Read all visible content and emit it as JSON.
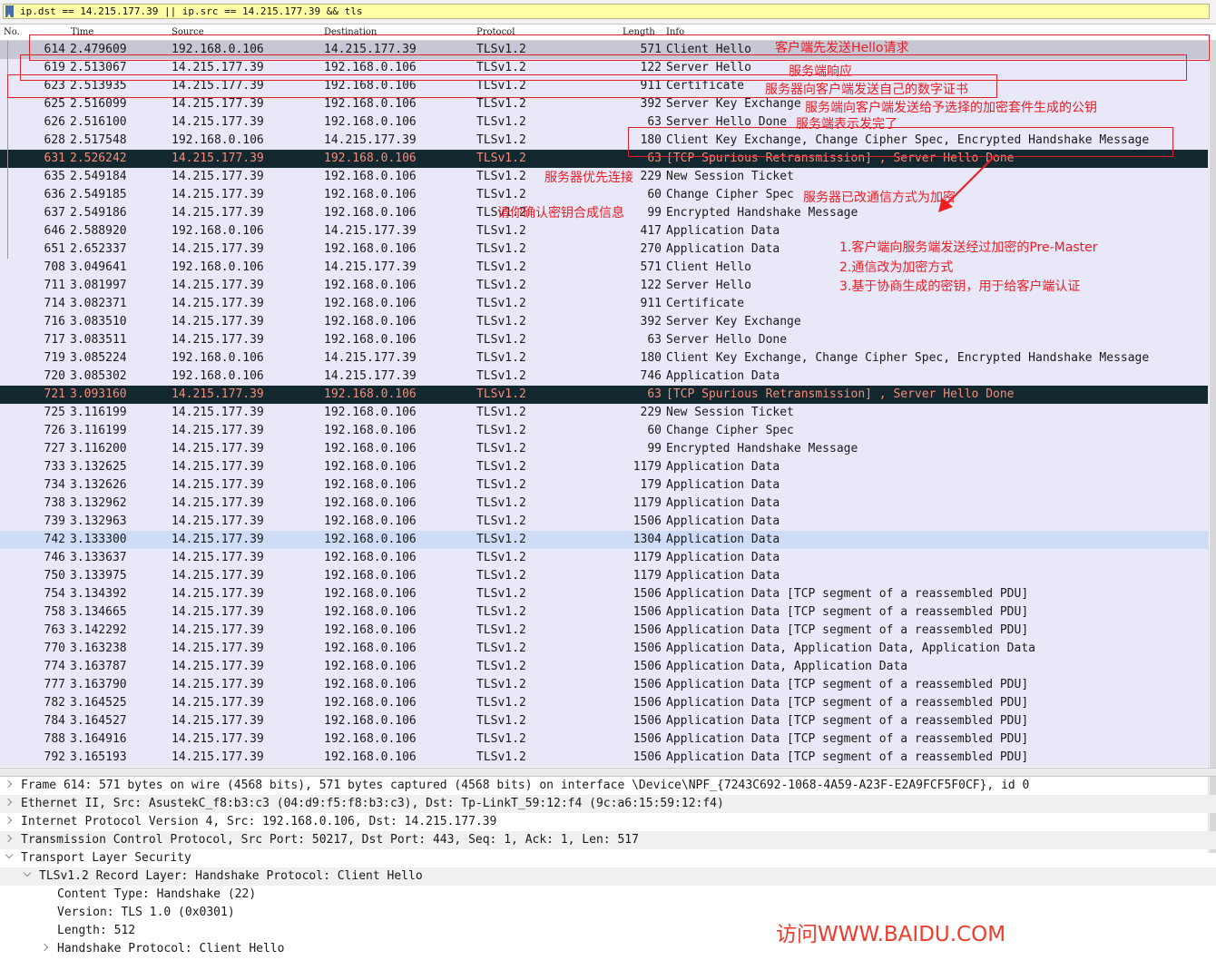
{
  "filter": {
    "icon": "bookmark-icon",
    "value": "ip.dst == 14.215.177.39 || ip.src == 14.215.177.39 && tls"
  },
  "columns": {
    "no": "No.",
    "time": "Time",
    "source": "Source",
    "destination": "Destination",
    "protocol": "Protocol",
    "length": "Length",
    "info": "Info"
  },
  "packets": [
    {
      "no": "614",
      "time": "2.479609",
      "src": "192.168.0.106",
      "dst": "14.215.177.39",
      "proto": "TLSv1.2",
      "len": "571",
      "info": "Client Hello",
      "state": "selected"
    },
    {
      "no": "619",
      "time": "2.513067",
      "src": "14.215.177.39",
      "dst": "192.168.0.106",
      "proto": "TLSv1.2",
      "len": "122",
      "info": "Server Hello",
      "state": "normal"
    },
    {
      "no": "623",
      "time": "2.513935",
      "src": "14.215.177.39",
      "dst": "192.168.0.106",
      "proto": "TLSv1.2",
      "len": "911",
      "info": "Certificate",
      "state": "normal"
    },
    {
      "no": "625",
      "time": "2.516099",
      "src": "14.215.177.39",
      "dst": "192.168.0.106",
      "proto": "TLSv1.2",
      "len": "392",
      "info": "Server Key Exchange",
      "state": "normal"
    },
    {
      "no": "626",
      "time": "2.516100",
      "src": "14.215.177.39",
      "dst": "192.168.0.106",
      "proto": "TLSv1.2",
      "len": "63",
      "info": "Server Hello Done",
      "state": "normal"
    },
    {
      "no": "628",
      "time": "2.517548",
      "src": "192.168.0.106",
      "dst": "14.215.177.39",
      "proto": "TLSv1.2",
      "len": "180",
      "info": "Client Key Exchange, Change Cipher Spec, Encrypted Handshake Message",
      "state": "normal"
    },
    {
      "no": "631",
      "time": "2.526242",
      "src": "14.215.177.39",
      "dst": "192.168.0.106",
      "proto": "TLSv1.2",
      "len": "63",
      "info": "[TCP Spurious Retransmission] , Server Hello Done",
      "state": "dark"
    },
    {
      "no": "635",
      "time": "2.549184",
      "src": "14.215.177.39",
      "dst": "192.168.0.106",
      "proto": "TLSv1.2",
      "len": "229",
      "info": "New Session Ticket",
      "state": "normal"
    },
    {
      "no": "636",
      "time": "2.549185",
      "src": "14.215.177.39",
      "dst": "192.168.0.106",
      "proto": "TLSv1.2",
      "len": "60",
      "info": "Change Cipher Spec",
      "state": "normal"
    },
    {
      "no": "637",
      "time": "2.549186",
      "src": "14.215.177.39",
      "dst": "192.168.0.106",
      "proto": "TLSv1.2",
      "len": "99",
      "info": "Encrypted Handshake Message",
      "state": "normal"
    },
    {
      "no": "646",
      "time": "2.588920",
      "src": "192.168.0.106",
      "dst": "14.215.177.39",
      "proto": "TLSv1.2",
      "len": "417",
      "info": "Application Data",
      "state": "normal"
    },
    {
      "no": "651",
      "time": "2.652337",
      "src": "14.215.177.39",
      "dst": "192.168.0.106",
      "proto": "TLSv1.2",
      "len": "270",
      "info": "Application Data",
      "state": "normal"
    },
    {
      "no": "708",
      "time": "3.049641",
      "src": "192.168.0.106",
      "dst": "14.215.177.39",
      "proto": "TLSv1.2",
      "len": "571",
      "info": "Client Hello",
      "state": "normal"
    },
    {
      "no": "711",
      "time": "3.081997",
      "src": "14.215.177.39",
      "dst": "192.168.0.106",
      "proto": "TLSv1.2",
      "len": "122",
      "info": "Server Hello",
      "state": "normal"
    },
    {
      "no": "714",
      "time": "3.082371",
      "src": "14.215.177.39",
      "dst": "192.168.0.106",
      "proto": "TLSv1.2",
      "len": "911",
      "info": "Certificate",
      "state": "normal"
    },
    {
      "no": "716",
      "time": "3.083510",
      "src": "14.215.177.39",
      "dst": "192.168.0.106",
      "proto": "TLSv1.2",
      "len": "392",
      "info": "Server Key Exchange",
      "state": "normal"
    },
    {
      "no": "717",
      "time": "3.083511",
      "src": "14.215.177.39",
      "dst": "192.168.0.106",
      "proto": "TLSv1.2",
      "len": "63",
      "info": "Server Hello Done",
      "state": "normal"
    },
    {
      "no": "719",
      "time": "3.085224",
      "src": "192.168.0.106",
      "dst": "14.215.177.39",
      "proto": "TLSv1.2",
      "len": "180",
      "info": "Client Key Exchange, Change Cipher Spec, Encrypted Handshake Message",
      "state": "normal"
    },
    {
      "no": "720",
      "time": "3.085302",
      "src": "192.168.0.106",
      "dst": "14.215.177.39",
      "proto": "TLSv1.2",
      "len": "746",
      "info": "Application Data",
      "state": "normal"
    },
    {
      "no": "721",
      "time": "3.093160",
      "src": "14.215.177.39",
      "dst": "192.168.0.106",
      "proto": "TLSv1.2",
      "len": "63",
      "info": "[TCP Spurious Retransmission] , Server Hello Done",
      "state": "dark"
    },
    {
      "no": "725",
      "time": "3.116199",
      "src": "14.215.177.39",
      "dst": "192.168.0.106",
      "proto": "TLSv1.2",
      "len": "229",
      "info": "New Session Ticket",
      "state": "normal"
    },
    {
      "no": "726",
      "time": "3.116199",
      "src": "14.215.177.39",
      "dst": "192.168.0.106",
      "proto": "TLSv1.2",
      "len": "60",
      "info": "Change Cipher Spec",
      "state": "normal"
    },
    {
      "no": "727",
      "time": "3.116200",
      "src": "14.215.177.39",
      "dst": "192.168.0.106",
      "proto": "TLSv1.2",
      "len": "99",
      "info": "Encrypted Handshake Message",
      "state": "normal"
    },
    {
      "no": "733",
      "time": "3.132625",
      "src": "14.215.177.39",
      "dst": "192.168.0.106",
      "proto": "TLSv1.2",
      "len": "1179",
      "info": "Application Data",
      "state": "normal"
    },
    {
      "no": "734",
      "time": "3.132626",
      "src": "14.215.177.39",
      "dst": "192.168.0.106",
      "proto": "TLSv1.2",
      "len": "179",
      "info": "Application Data",
      "state": "normal"
    },
    {
      "no": "738",
      "time": "3.132962",
      "src": "14.215.177.39",
      "dst": "192.168.0.106",
      "proto": "TLSv1.2",
      "len": "1179",
      "info": "Application Data",
      "state": "normal"
    },
    {
      "no": "739",
      "time": "3.132963",
      "src": "14.215.177.39",
      "dst": "192.168.0.106",
      "proto": "TLSv1.2",
      "len": "1506",
      "info": "Application Data",
      "state": "normal"
    },
    {
      "no": "742",
      "time": "3.133300",
      "src": "14.215.177.39",
      "dst": "192.168.0.106",
      "proto": "TLSv1.2",
      "len": "1304",
      "info": "Application Data",
      "state": "hl"
    },
    {
      "no": "746",
      "time": "3.133637",
      "src": "14.215.177.39",
      "dst": "192.168.0.106",
      "proto": "TLSv1.2",
      "len": "1179",
      "info": "Application Data",
      "state": "normal"
    },
    {
      "no": "750",
      "time": "3.133975",
      "src": "14.215.177.39",
      "dst": "192.168.0.106",
      "proto": "TLSv1.2",
      "len": "1179",
      "info": "Application Data",
      "state": "normal"
    },
    {
      "no": "754",
      "time": "3.134392",
      "src": "14.215.177.39",
      "dst": "192.168.0.106",
      "proto": "TLSv1.2",
      "len": "1506",
      "info": "Application Data [TCP segment of a reassembled PDU]",
      "state": "normal"
    },
    {
      "no": "758",
      "time": "3.134665",
      "src": "14.215.177.39",
      "dst": "192.168.0.106",
      "proto": "TLSv1.2",
      "len": "1506",
      "info": "Application Data [TCP segment of a reassembled PDU]",
      "state": "normal"
    },
    {
      "no": "763",
      "time": "3.142292",
      "src": "14.215.177.39",
      "dst": "192.168.0.106",
      "proto": "TLSv1.2",
      "len": "1506",
      "info": "Application Data [TCP segment of a reassembled PDU]",
      "state": "normal"
    },
    {
      "no": "770",
      "time": "3.163238",
      "src": "14.215.177.39",
      "dst": "192.168.0.106",
      "proto": "TLSv1.2",
      "len": "1506",
      "info": "Application Data, Application Data, Application Data",
      "state": "normal"
    },
    {
      "no": "774",
      "time": "3.163787",
      "src": "14.215.177.39",
      "dst": "192.168.0.106",
      "proto": "TLSv1.2",
      "len": "1506",
      "info": "Application Data, Application Data",
      "state": "normal"
    },
    {
      "no": "777",
      "time": "3.163790",
      "src": "14.215.177.39",
      "dst": "192.168.0.106",
      "proto": "TLSv1.2",
      "len": "1506",
      "info": "Application Data [TCP segment of a reassembled PDU]",
      "state": "normal"
    },
    {
      "no": "782",
      "time": "3.164525",
      "src": "14.215.177.39",
      "dst": "192.168.0.106",
      "proto": "TLSv1.2",
      "len": "1506",
      "info": "Application Data [TCP segment of a reassembled PDU]",
      "state": "normal"
    },
    {
      "no": "784",
      "time": "3.164527",
      "src": "14.215.177.39",
      "dst": "192.168.0.106",
      "proto": "TLSv1.2",
      "len": "1506",
      "info": "Application Data [TCP segment of a reassembled PDU]",
      "state": "normal"
    },
    {
      "no": "788",
      "time": "3.164916",
      "src": "14.215.177.39",
      "dst": "192.168.0.106",
      "proto": "TLSv1.2",
      "len": "1506",
      "info": "Application Data [TCP segment of a reassembled PDU]",
      "state": "normal"
    },
    {
      "no": "792",
      "time": "3.165193",
      "src": "14.215.177.39",
      "dst": "192.168.0.106",
      "proto": "TLSv1.2",
      "len": "1506",
      "info": "Application Data [TCP segment of a reassembled PDU]",
      "state": "normal"
    }
  ],
  "details": [
    {
      "text": "Frame 614: 571 bytes on wire (4568 bits), 571 bytes captured (4568 bits) on interface \\Device\\NPF_{7243C692-1068-4A59-A23F-E2A9FCF5F0CF}, id 0",
      "level": 0,
      "arrow": "right",
      "shade": false
    },
    {
      "text": "Ethernet II, Src: AsustekC_f8:b3:c3 (04:d9:f5:f8:b3:c3), Dst: Tp-LinkT_59:12:f4 (9c:a6:15:59:12:f4)",
      "level": 0,
      "arrow": "right",
      "shade": true
    },
    {
      "text": "Internet Protocol Version 4, Src: 192.168.0.106, Dst: 14.215.177.39",
      "level": 0,
      "arrow": "right",
      "shade": false
    },
    {
      "text": "Transmission Control Protocol, Src Port: 50217, Dst Port: 443, Seq: 1, Ack: 1, Len: 517",
      "level": 0,
      "arrow": "right",
      "shade": true
    },
    {
      "text": "Transport Layer Security",
      "level": 0,
      "arrow": "down",
      "shade": false
    },
    {
      "text": "TLSv1.2 Record Layer: Handshake Protocol: Client Hello",
      "level": 1,
      "arrow": "down",
      "shade": true
    },
    {
      "text": "Content Type: Handshake (22)",
      "level": 2,
      "arrow": "",
      "shade": false
    },
    {
      "text": "Version: TLS 1.0 (0x0301)",
      "level": 2,
      "arrow": "",
      "shade": false
    },
    {
      "text": "Length: 512",
      "level": 2,
      "arrow": "",
      "shade": false
    },
    {
      "text": "Handshake Protocol: Client Hello",
      "level": 2,
      "arrow": "right",
      "shade": false
    }
  ],
  "annotations": {
    "client_hello": "客户端先发送Hello请求",
    "server_hello": "服务端响应",
    "certificate": "服务器向客户端发送自己的数字证书",
    "key_exchange": "服务端向客户端发送给予选择的加密套件生成的公钥",
    "hello_done": "服务端表示发完了",
    "server_priority": "服务器优先连接",
    "cipher_changed": "服务器已改通信方式为加密",
    "confirm_key": "请你确认密钥合成信息",
    "note_1": "1.客户端向服务端发送经过加密的Pre-Master",
    "note_2": "2.通信改为加密方式",
    "note_3": "3.基于协商生成的密钥，用于给客户端认证",
    "watermark": "访问WWW.BAIDU.COM"
  },
  "colors": {
    "annotation": "#ee1c24",
    "row_bg": "#e8e8f8",
    "row_selected": "#c6c6d4",
    "row_dark": "#12272e",
    "row_dark_text": "#f78b7b",
    "filter_bg": "#ffffa8"
  }
}
